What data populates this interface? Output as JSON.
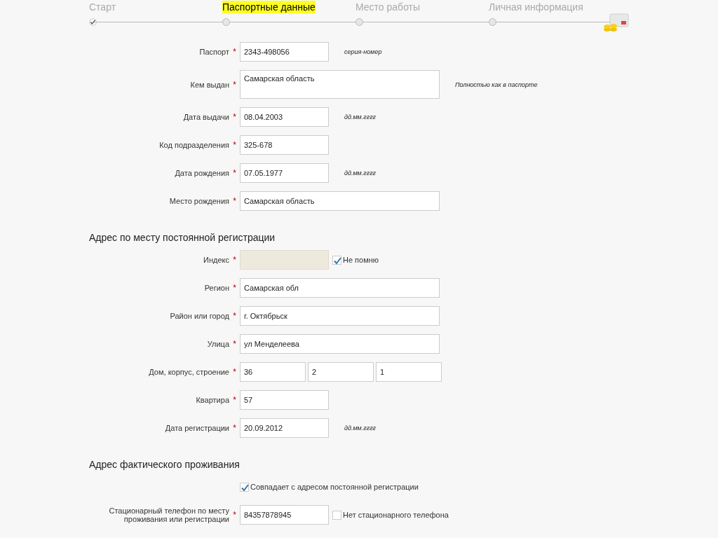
{
  "steps": [
    {
      "label": "Старт",
      "selected": false,
      "done": true
    },
    {
      "label": "Паспортные данные",
      "selected": true,
      "done": false
    },
    {
      "label": "Место работы",
      "selected": false,
      "done": false
    },
    {
      "label": "Личная информация",
      "selected": false,
      "done": false
    }
  ],
  "sections": [
    {
      "rows": [
        {
          "kind": "field",
          "label": "Паспорт",
          "required_mark": "*",
          "fields": [
            {
              "value": "2343-498056",
              "kind": "short",
              "disabled": false
            }
          ],
          "hint": "серия-номер"
        },
        {
          "kind": "field",
          "label": "Кем выдан",
          "required_mark": "*",
          "fields": [
            {
              "value": "Самарская область",
              "kind": "tall",
              "disabled": false
            }
          ],
          "hint": "Полностью как в паспорте"
        },
        {
          "kind": "field",
          "label": "Дата выдачи",
          "required_mark": "*",
          "fields": [
            {
              "value": "08.04.2003",
              "kind": "short",
              "disabled": false
            }
          ],
          "hint": "дд.мм.гггг"
        },
        {
          "kind": "field",
          "label": "Код подразделения",
          "required_mark": "*",
          "fields": [
            {
              "value": "325-678",
              "kind": "short",
              "disabled": false
            }
          ]
        },
        {
          "kind": "field",
          "label": "Дата рождения",
          "required_mark": "*",
          "fields": [
            {
              "value": "07.05.1977",
              "kind": "short",
              "disabled": false
            }
          ],
          "hint": "дд.мм.гггг"
        },
        {
          "kind": "field",
          "label": "Место рождения",
          "required_mark": "*",
          "fields": [
            {
              "value": "Самарская область",
              "kind": "long",
              "disabled": false
            }
          ]
        }
      ]
    },
    {
      "title": "Адрес по месту постоянной регистрации",
      "rows": [
        {
          "kind": "field",
          "label": "Индекс",
          "required_mark": "*",
          "fields": [
            {
              "kind": "short",
              "disabled": true
            }
          ],
          "checkbox": {
            "label": "Не помню",
            "checked": true
          }
        },
        {
          "kind": "field",
          "label": "Регион",
          "required_mark": "*",
          "fields": [
            {
              "value": "Самарская обл",
              "kind": "long",
              "disabled": false
            }
          ]
        },
        {
          "kind": "field",
          "label": "Район или город",
          "required_mark": "*",
          "fields": [
            {
              "value": "г. Октябрьск",
              "kind": "long",
              "disabled": false
            }
          ]
        },
        {
          "kind": "field",
          "label": "Улица",
          "required_mark": "*",
          "fields": [
            {
              "value": "ул Менделеева",
              "kind": "long",
              "disabled": false
            }
          ]
        },
        {
          "kind": "field",
          "label": "Дом, корпус, строение",
          "required_mark": "*",
          "fields": [
            {
              "value": "36",
              "kind": "third",
              "disabled": false
            },
            {
              "value": "2",
              "kind": "third",
              "disabled": false
            },
            {
              "value": "1",
              "kind": "third",
              "disabled": false
            }
          ]
        },
        {
          "kind": "field",
          "label": "Квартира",
          "required_mark": "*",
          "fields": [
            {
              "value": "57",
              "kind": "short",
              "disabled": false
            }
          ]
        },
        {
          "kind": "field",
          "label": "Дата регистрации",
          "required_mark": "*",
          "fields": [
            {
              "value": "20.09.2012",
              "kind": "short",
              "disabled": false
            }
          ],
          "hint": "дд.мм.гггг"
        }
      ]
    },
    {
      "title": "Адрес фактического проживания",
      "rows": [
        {
          "kind": "checkbox",
          "checkbox": {
            "label": "Совпадает с адресом постоянной регистрации",
            "checked": true
          }
        },
        {
          "kind": "field",
          "label": "Стационарный телефон по месту проживания или регистрации",
          "required_mark": "*",
          "fields": [
            {
              "value": "84357878945",
              "kind": "short",
              "disabled": false
            }
          ],
          "checkbox": {
            "label": "Нет стационарного телефона",
            "checked": false
          }
        }
      ]
    }
  ]
}
